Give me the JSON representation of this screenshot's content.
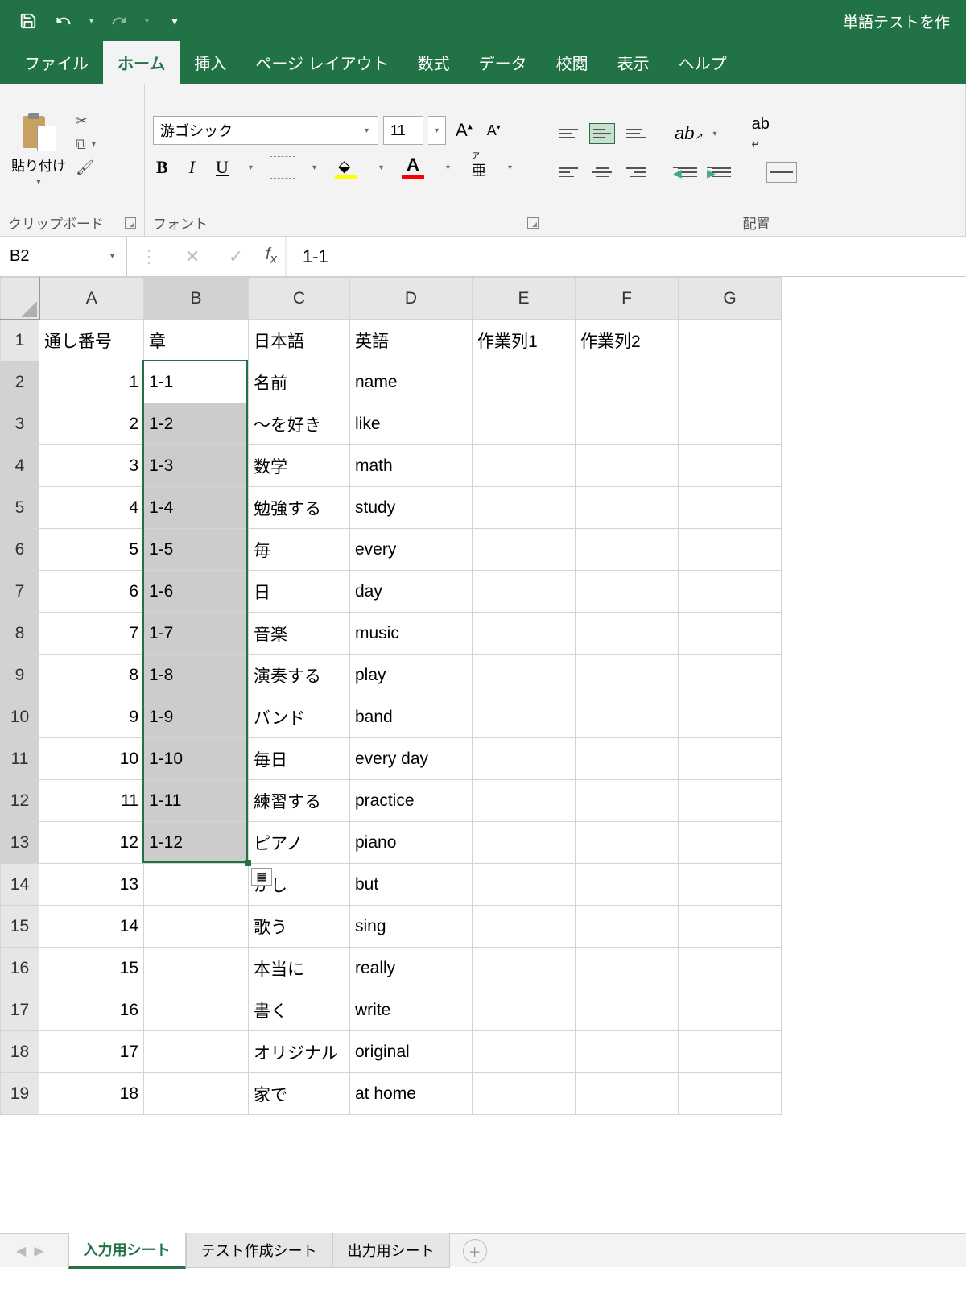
{
  "title": "単語テストを作",
  "qat": {
    "save": "save",
    "undo": "undo",
    "redo": "redo"
  },
  "tabs": {
    "file": "ファイル",
    "home": "ホーム",
    "insert": "挿入",
    "layout": "ページ レイアウト",
    "formulas": "数式",
    "data": "データ",
    "review": "校閲",
    "view": "表示",
    "help": "ヘルプ"
  },
  "ribbon": {
    "clipboard": {
      "paste": "貼り付け",
      "label": "クリップボード"
    },
    "font": {
      "name": "游ゴシック",
      "size": "11",
      "label": "フォント"
    },
    "align": {
      "label": "配置"
    }
  },
  "namebox": "B2",
  "formula": "1-1",
  "columns": [
    "A",
    "B",
    "C",
    "D",
    "E",
    "F",
    "G"
  ],
  "headers": {
    "A": "通し番号",
    "B": "章",
    "C": "日本語",
    "D": "英語",
    "E": "作業列1",
    "F": "作業列2"
  },
  "rows": [
    {
      "n": 1,
      "A": "1",
      "B": "1-1",
      "C": "名前",
      "D": "name"
    },
    {
      "n": 2,
      "A": "2",
      "B": "1-2",
      "C": "～を好き",
      "D": "like"
    },
    {
      "n": 3,
      "A": "3",
      "B": "1-3",
      "C": "数学",
      "D": "math"
    },
    {
      "n": 4,
      "A": "4",
      "B": "1-4",
      "C": "勉強する",
      "D": "study"
    },
    {
      "n": 5,
      "A": "5",
      "B": "1-5",
      "C": "毎",
      "D": "every"
    },
    {
      "n": 6,
      "A": "6",
      "B": "1-6",
      "C": "日",
      "D": "day"
    },
    {
      "n": 7,
      "A": "7",
      "B": "1-7",
      "C": "音楽",
      "D": "music"
    },
    {
      "n": 8,
      "A": "8",
      "B": "1-8",
      "C": "演奏する",
      "D": "play"
    },
    {
      "n": 9,
      "A": "9",
      "B": "1-9",
      "C": "バンド",
      "D": "band"
    },
    {
      "n": 10,
      "A": "10",
      "B": "1-10",
      "C": "毎日",
      "D": "every day"
    },
    {
      "n": 11,
      "A": "11",
      "B": "1-11",
      "C": "練習する",
      "D": "practice"
    },
    {
      "n": 12,
      "A": "12",
      "B": "1-12",
      "C": "ピアノ",
      "D": "piano"
    },
    {
      "n": 13,
      "A": "13",
      "B": "",
      "C": "かし",
      "D": "but"
    },
    {
      "n": 14,
      "A": "14",
      "B": "",
      "C": "歌う",
      "D": "sing"
    },
    {
      "n": 15,
      "A": "15",
      "B": "",
      "C": "本当に",
      "D": "really"
    },
    {
      "n": 16,
      "A": "16",
      "B": "",
      "C": "書く",
      "D": "write"
    },
    {
      "n": 17,
      "A": "17",
      "B": "",
      "C": "オリジナル",
      "D": "original"
    },
    {
      "n": 18,
      "A": "18",
      "B": "",
      "C": "家で",
      "D": "at home"
    }
  ],
  "sheets": {
    "s1": "入力用シート",
    "s2": "テスト作成シート",
    "s3": "出力用シート"
  },
  "selection": {
    "col": "B",
    "row_start": 2,
    "row_end": 13
  }
}
